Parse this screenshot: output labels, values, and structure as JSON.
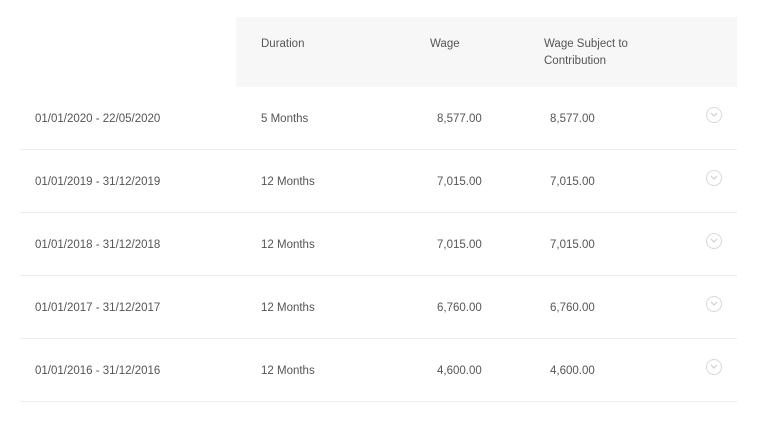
{
  "table": {
    "headers": {
      "duration": "Duration",
      "wage": "Wage",
      "wage_subject_to_contribution": "Wage Subject to Contribution"
    },
    "rows": [
      {
        "period": "01/01/2020 - 22/05/2020",
        "duration": "5 Months",
        "wage": "8,577.00",
        "wage_subject": "8,577.00"
      },
      {
        "period": "01/01/2019 - 31/12/2019",
        "duration": "12 Months",
        "wage": "7,015.00",
        "wage_subject": "7,015.00"
      },
      {
        "period": "01/01/2018 - 31/12/2018",
        "duration": "12 Months",
        "wage": "7,015.00",
        "wage_subject": "7,015.00"
      },
      {
        "period": "01/01/2017 - 31/12/2017",
        "duration": "12 Months",
        "wage": "6,760.00",
        "wage_subject": "6,760.00"
      },
      {
        "period": "01/01/2016 - 31/12/2016",
        "duration": "12 Months",
        "wage": "4,600.00",
        "wage_subject": "4,600.00"
      }
    ],
    "row_action_icon": "chevron-down-icon",
    "colors": {
      "header_bg": "#f7f7f7",
      "divider": "#ececec",
      "text": "#555555"
    }
  }
}
